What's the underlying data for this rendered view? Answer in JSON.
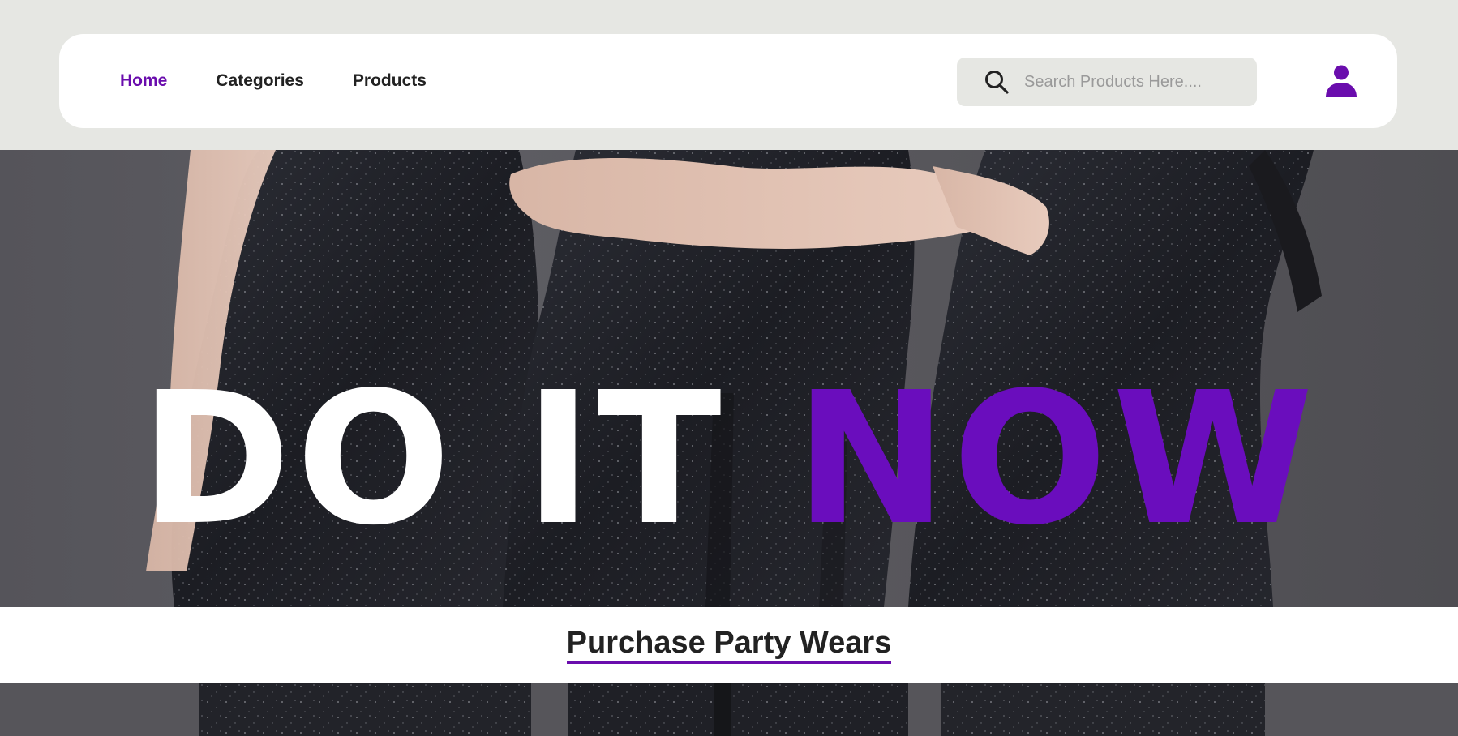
{
  "nav": {
    "links": [
      {
        "label": "Home",
        "active": true
      },
      {
        "label": "Categories",
        "active": false
      },
      {
        "label": "Products",
        "active": false
      }
    ]
  },
  "search": {
    "placeholder": "Search Products Here...."
  },
  "icons": {
    "search": "search-icon",
    "user": "user-icon"
  },
  "hero": {
    "headline_white": "DO IT ",
    "headline_purple": "NOW"
  },
  "banner": {
    "title": "Purchase Party Wears"
  },
  "colors": {
    "accent": "#6a0dad",
    "header_background": "#e6e7e3",
    "navbar_background": "#ffffff",
    "text_dark": "#222222"
  }
}
